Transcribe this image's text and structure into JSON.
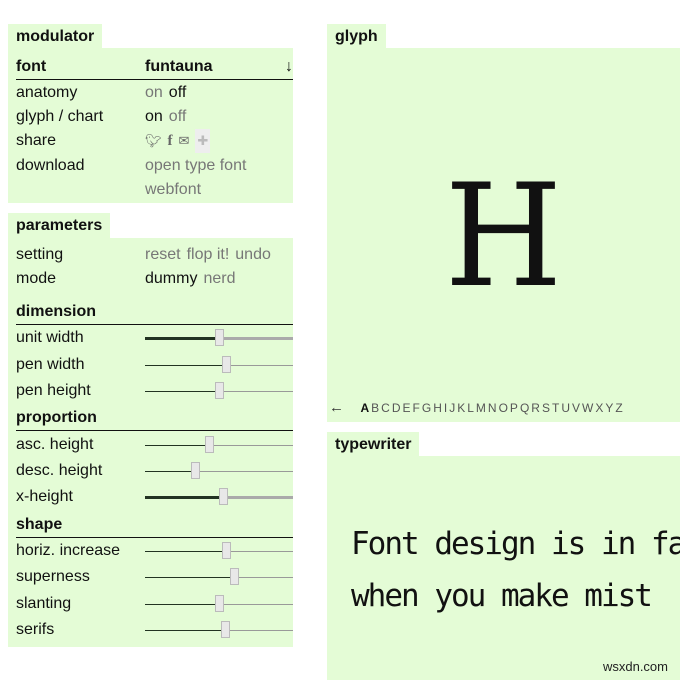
{
  "modulator": {
    "title": "modulator",
    "font_label": "font",
    "font_value": "funtauna",
    "font_icon": "arrow-down-icon",
    "font_arrow": "↓",
    "anatomy": {
      "label": "anatomy",
      "on": "on",
      "off": "off",
      "selected": "off"
    },
    "glyph_chart": {
      "label": "glyph / chart",
      "on": "on",
      "off": "off",
      "selected": "on"
    },
    "share": {
      "label": "share",
      "icons": [
        "twitter-icon",
        "facebook-icon",
        "mail-icon",
        "puzzle-icon"
      ]
    },
    "download": {
      "label": "download",
      "opentype": "open type font",
      "webfont": "webfont"
    }
  },
  "parameters": {
    "title": "parameters",
    "setting": {
      "label": "setting",
      "reset": "reset",
      "flop": "flop it!",
      "undo": "undo"
    },
    "mode": {
      "label": "mode",
      "dummy": "dummy",
      "nerd": "nerd",
      "selected": "dummy"
    },
    "groups": [
      {
        "title": "dimension",
        "sliders": [
          {
            "label": "unit width",
            "value": 0.5,
            "thick": true
          },
          {
            "label": "pen width",
            "value": 0.55,
            "thick": false
          },
          {
            "label": "pen height",
            "value": 0.5,
            "thick": false
          }
        ]
      },
      {
        "title": "proportion",
        "sliders": [
          {
            "label": "asc. height",
            "value": 0.43,
            "thick": false
          },
          {
            "label": "desc. height",
            "value": 0.34,
            "thick": false
          },
          {
            "label": "x-height",
            "value": 0.53,
            "thick": true
          }
        ]
      },
      {
        "title": "shape",
        "sliders": [
          {
            "label": "horiz. increase",
            "value": 0.55,
            "thick": false
          },
          {
            "label": "superness",
            "value": 0.6,
            "thick": false
          },
          {
            "label": "slanting",
            "value": 0.5,
            "thick": false
          },
          {
            "label": "serifs",
            "value": 0.54,
            "thick": false
          }
        ]
      }
    ]
  },
  "glyph": {
    "title": "glyph",
    "char": "H",
    "back_arrow": "←",
    "letters": [
      "A",
      "B",
      "C",
      "D",
      "E",
      "F",
      "G",
      "H",
      "I",
      "J",
      "K",
      "L",
      "M",
      "N",
      "O",
      "P",
      "Q",
      "R",
      "S",
      "T",
      "U",
      "V",
      "W",
      "X",
      "Y",
      "Z"
    ],
    "selected_letter": "A"
  },
  "typewriter": {
    "title": "typewriter",
    "line1": "Font design is in fact",
    "line2": "when you make mist"
  },
  "watermark": "wsxdn.com",
  "colors": {
    "panel": "#e4fcd6",
    "muted": "#777777"
  }
}
